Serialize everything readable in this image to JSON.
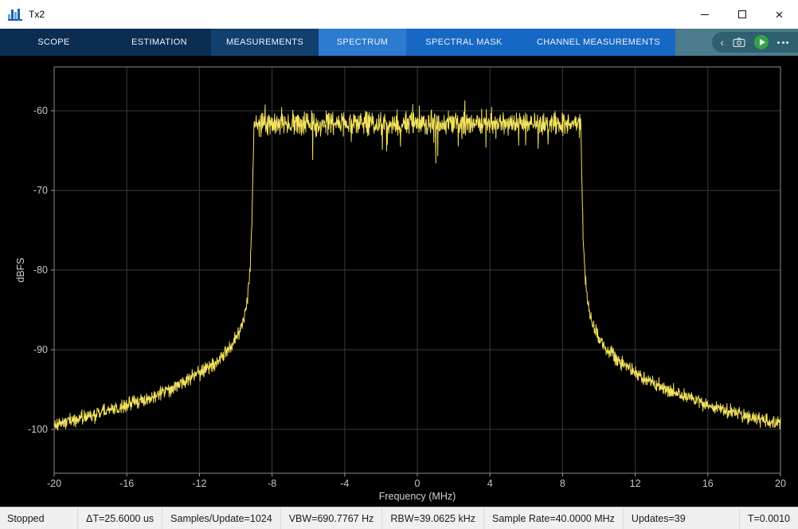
{
  "window": {
    "title": "Tx2"
  },
  "titlebar": {
    "close_glyph": "×"
  },
  "icons": {
    "app": "histogram-icon",
    "minimize": "minimize-icon",
    "maximize": "maximize-icon",
    "close": "close-icon",
    "collapse": "chevron-left-icon",
    "snapshot": "camera-icon",
    "run": "play-icon",
    "more": "ellipsis-icon"
  },
  "toolstrip": {
    "tabs": [
      {
        "label": "SCOPE",
        "active": false
      },
      {
        "label": "ESTIMATION",
        "active": false
      },
      {
        "label": "MEASUREMENTS",
        "active": true
      }
    ],
    "subtabs": [
      {
        "label": "SPECTRUM",
        "active": true
      },
      {
        "label": "SPECTRAL MASK",
        "active": false
      },
      {
        "label": "CHANNEL MEASUREMENTS",
        "active": false
      }
    ],
    "run_controls": {
      "collapse_glyph": "‹"
    }
  },
  "statusbar": {
    "state": "Stopped",
    "segments": [
      "ΔT=25.6000 us",
      "Samples/Update=1024",
      "VBW=690.7767 Hz",
      "RBW=39.0625 kHz",
      "Sample Rate=40.0000 MHz",
      "Updates=39",
      "T=0.0010"
    ]
  },
  "chart_data": {
    "type": "line",
    "title": "",
    "xlabel": "Frequency (MHz)",
    "ylabel": "dBFS",
    "xlim": [
      -20,
      20
    ],
    "ylim": [
      -105.5,
      -54.5
    ],
    "x_ticks": [
      -20,
      -16,
      -12,
      -8,
      -4,
      0,
      4,
      8,
      12,
      16,
      20
    ],
    "y_ticks": [
      -60,
      -70,
      -80,
      -90,
      -100
    ],
    "grid": true,
    "legend": "none",
    "background": "#000000",
    "grid_color": "#3b3b3b",
    "axis_color": "#8a8a8a",
    "line_color": "#f2e15c",
    "series_name": "spectrum-trace",
    "signal": {
      "description": "Flat-top noise-like passband from -9 to 9 MHz at about -61.6 dBFS with steep skirts falling to a sloped noise floor near -100 dBFS at the band edges",
      "passband_mhz": [
        -9,
        9
      ],
      "passband_level_dbfs": -61.6,
      "passband_noise_db": 1.9,
      "stopband_noise_db": 1.1,
      "envelope_points": [
        [
          -20,
          -99.3
        ],
        [
          -18,
          -98.3
        ],
        [
          -16,
          -96.9
        ],
        [
          -14,
          -95.3
        ],
        [
          -12,
          -92.9
        ],
        [
          -11,
          -91.3
        ],
        [
          -10.4,
          -89.9
        ],
        [
          -10,
          -88.7
        ],
        [
          -9.7,
          -87.2
        ],
        [
          -9.5,
          -85.5
        ],
        [
          -9.35,
          -83.4
        ],
        [
          -9.22,
          -80
        ],
        [
          -9.12,
          -75
        ],
        [
          -9.04,
          -66.5
        ],
        [
          -9.0,
          -61.6
        ],
        [
          9.0,
          -61.6
        ],
        [
          9.04,
          -66.5
        ],
        [
          9.12,
          -75
        ],
        [
          9.22,
          -80
        ],
        [
          9.35,
          -83.4
        ],
        [
          9.5,
          -85.5
        ],
        [
          9.7,
          -87.2
        ],
        [
          10,
          -88.7
        ],
        [
          10.4,
          -89.9
        ],
        [
          11,
          -91.3
        ],
        [
          12,
          -92.9
        ],
        [
          14,
          -95.3
        ],
        [
          16,
          -96.9
        ],
        [
          18,
          -98.3
        ],
        [
          20,
          -99.3
        ]
      ],
      "seed": 1337,
      "points": 2200
    }
  }
}
